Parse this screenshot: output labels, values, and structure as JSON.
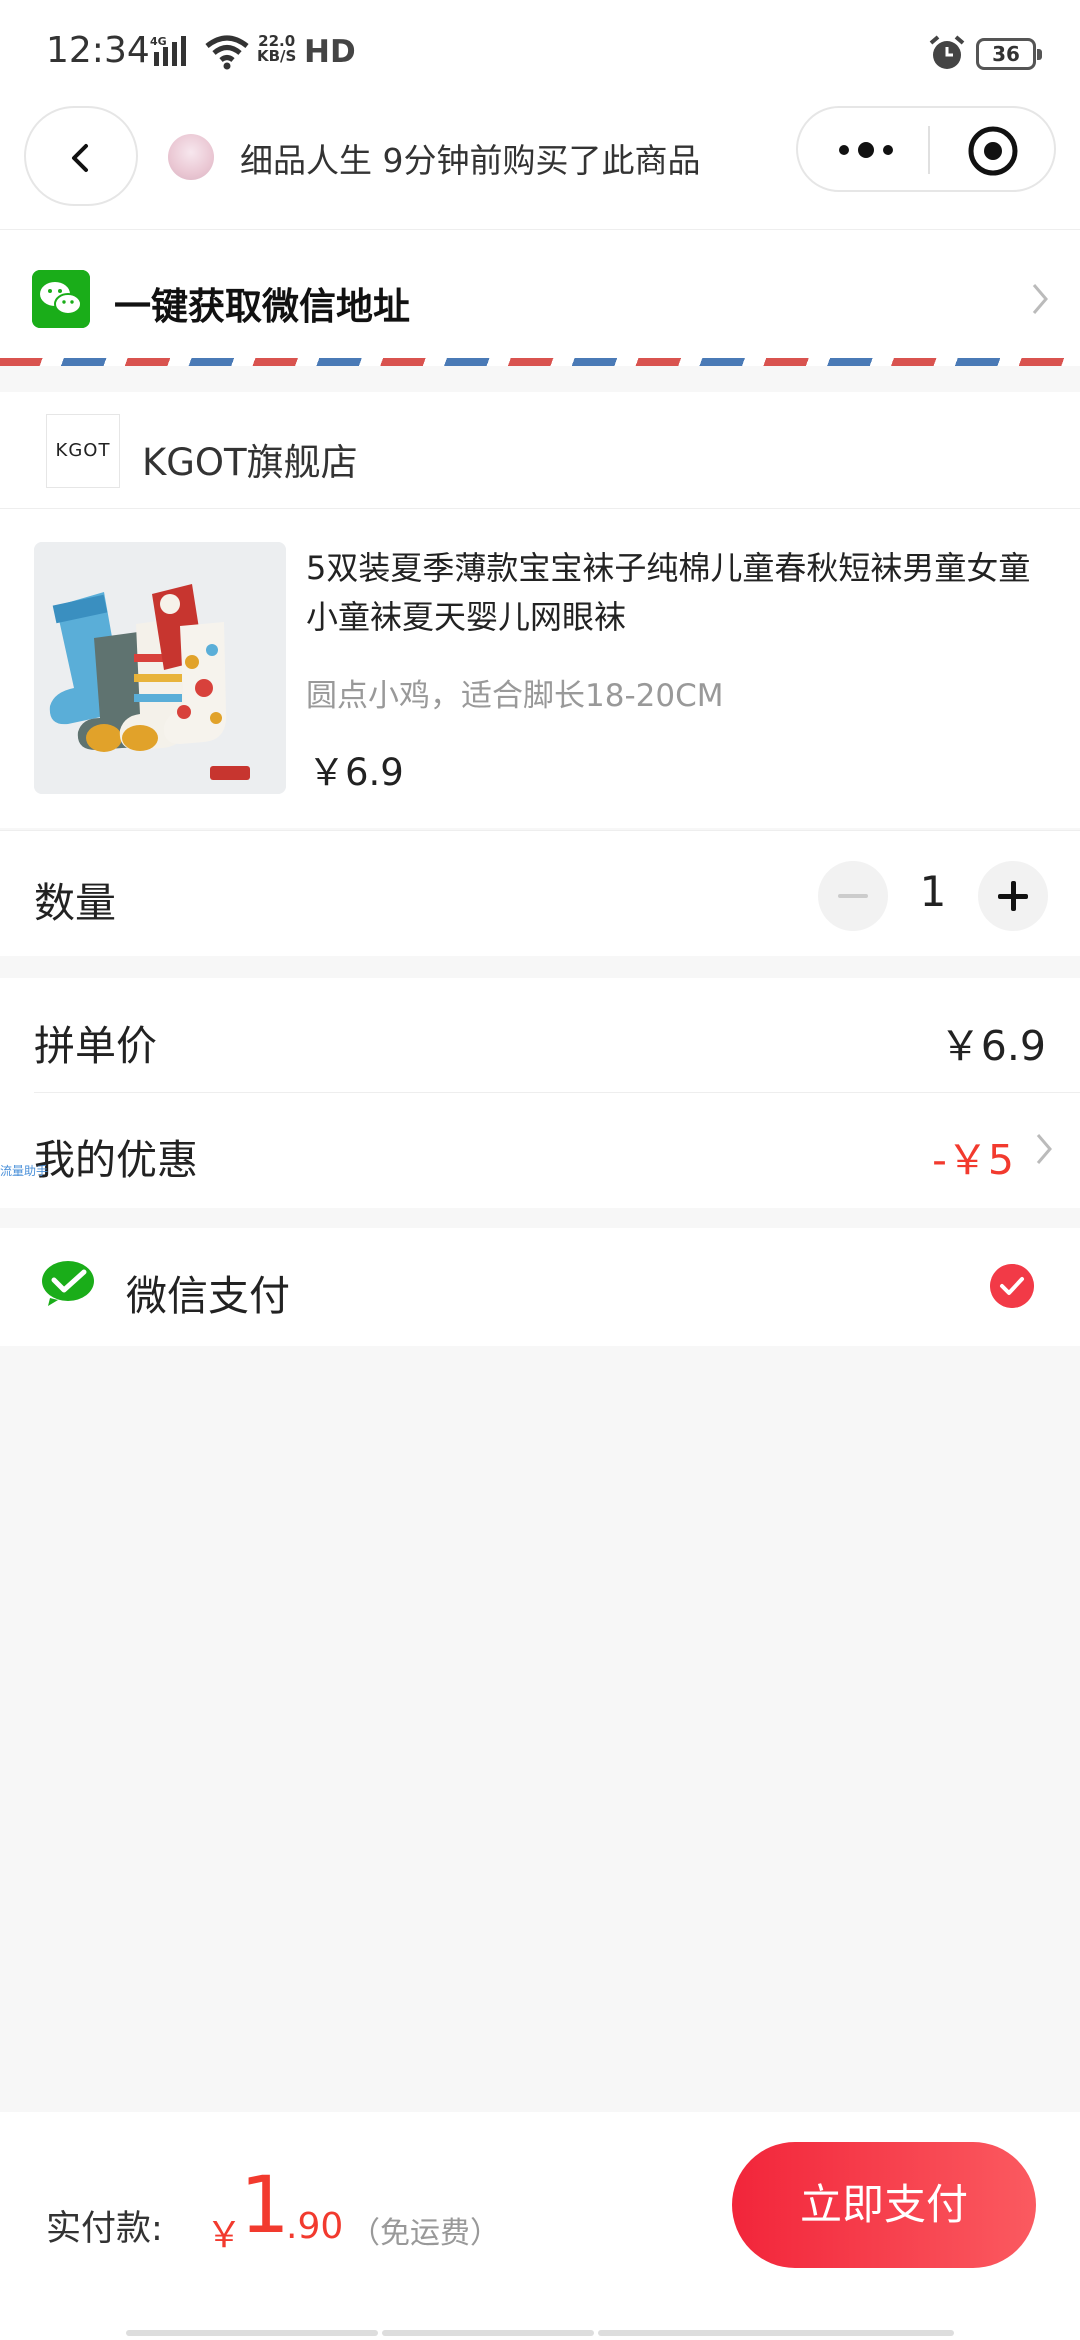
{
  "status_bar": {
    "time": "12:34",
    "network": "4G",
    "speed_top": "22.0",
    "speed_bottom": "KB/S",
    "hd": "HD",
    "battery": "36"
  },
  "nav": {
    "banner_text": "细品人生 9分钟前购买了此商品"
  },
  "address": {
    "label": "一键获取微信地址"
  },
  "shop": {
    "logo_text": "KGOT",
    "name": "KGOT旗舰店"
  },
  "product": {
    "title": "5双装夏季薄款宝宝袜子纯棉儿童春秋短袜男童女童小童袜夏天婴儿网眼袜",
    "spec": "圆点小鸡，适合脚长18-20CM",
    "price": "￥6.9"
  },
  "quantity": {
    "label": "数量",
    "value": "1"
  },
  "pricing": {
    "unit_label": "拼单价",
    "unit_value": "￥6.9",
    "discount_label": "我的优惠",
    "discount_value": "-￥5",
    "tiny_link": "流量助手"
  },
  "payment": {
    "method_label": "微信支付",
    "selected": true
  },
  "bottom": {
    "total_label": "实付款:",
    "currency": "￥",
    "total_integer": "1",
    "total_decimal": ".90",
    "shipping_note": "（免运费）",
    "pay_button": "立即支付"
  },
  "colors": {
    "accent_red": "#f23a2e",
    "wechat_green": "#1aad19",
    "pay_button_start": "#f2253a",
    "pay_button_end": "#fb5a60"
  },
  "icons": [
    "signal-icon",
    "wifi-icon",
    "alarm-icon",
    "battery-icon",
    "back-icon",
    "more-icon",
    "target-icon",
    "wechat-icon",
    "chevron-right-icon",
    "minus-icon",
    "plus-icon",
    "wechat-pay-icon",
    "check-icon"
  ]
}
